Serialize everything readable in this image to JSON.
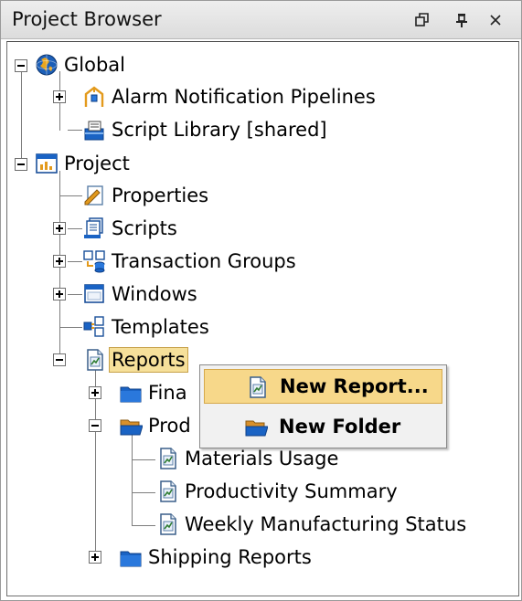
{
  "panel": {
    "title": "Project Browser",
    "controls": [
      "restore-icon",
      "pin-icon",
      "close-icon"
    ]
  },
  "tree": {
    "global": {
      "label": "Global",
      "children": {
        "alarm": "Alarm Notification Pipelines",
        "scripts": "Script Library [shared]"
      }
    },
    "project": {
      "label": "Project",
      "children": {
        "properties": "Properties",
        "scripts": "Scripts",
        "transaction_groups": "Transaction Groups",
        "windows": "Windows",
        "templates": "Templates",
        "reports": {
          "label": "Reports",
          "children": {
            "folder1": "Fina",
            "folder2": "Prod",
            "materials": "Materials Usage",
            "productivity": "Productivity Summary",
            "weekly": "Weekly Manufacturing Status",
            "shipping": "Shipping Reports"
          }
        }
      }
    }
  },
  "context_menu": {
    "new_report": "New Report...",
    "new_folder": "New Folder"
  },
  "colors": {
    "selection": "#f6e09a",
    "menu_hover": "#f7d88a",
    "folder": "#1a63c4"
  }
}
